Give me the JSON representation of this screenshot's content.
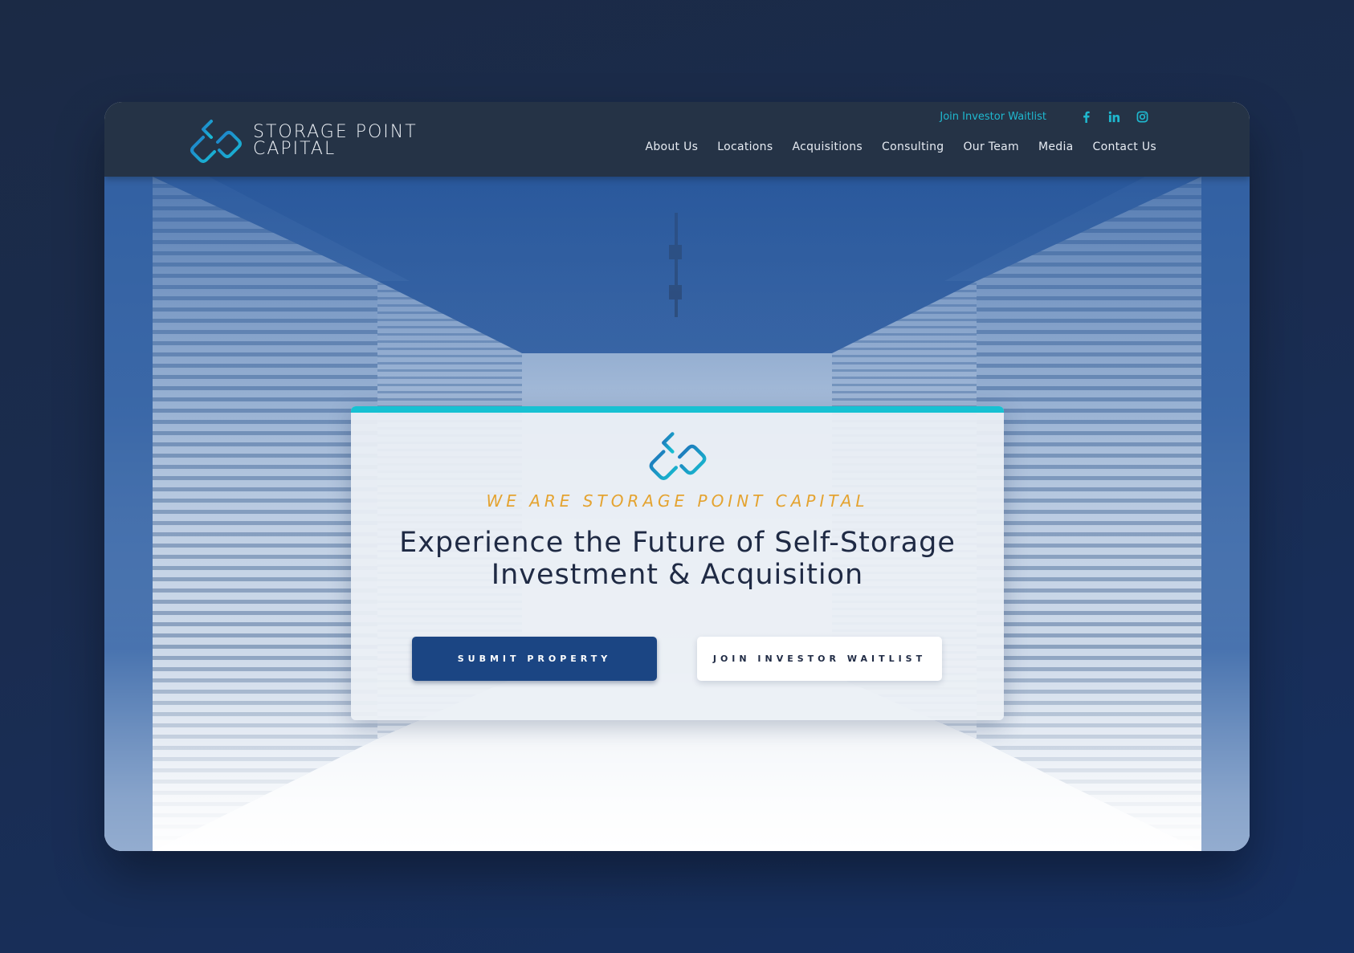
{
  "brand": {
    "line1": "STORAGE POINT",
    "line2": "CAPITAL",
    "logo_icon": "linked-chain-logo-icon"
  },
  "utility": {
    "waitlist_link": "Join Investor Waitlist",
    "social_icons": [
      "facebook-icon",
      "linkedin-icon",
      "instagram-icon"
    ]
  },
  "nav": {
    "items": [
      "About Us",
      "Locations",
      "Acquisitions",
      "Consulting",
      "Our Team",
      "Media",
      "Contact Us"
    ]
  },
  "hero": {
    "tagline": "WE ARE STORAGE POINT CAPITAL",
    "headline": "Experience the Future of Self-Storage Investment & Acquisition",
    "primary_button": "SUBMIT PROPERTY",
    "secondary_button": "JOIN INVESTOR WAITLIST"
  },
  "colors": {
    "header_bg": "#253346",
    "accent_teal": "#17c1d2",
    "tagline_gold": "#e4a330",
    "primary_button_bg": "#1b4583",
    "page_bg": "#1a2c4f"
  }
}
